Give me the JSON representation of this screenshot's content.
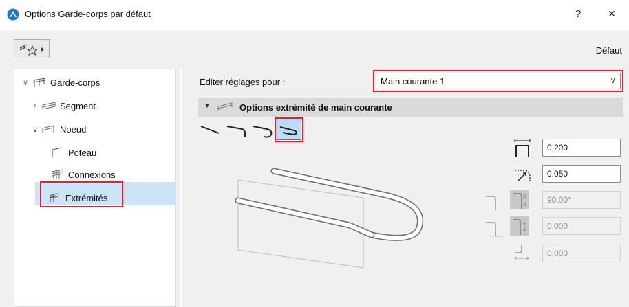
{
  "window": {
    "title": "Options Garde-corps par défaut",
    "help": "?",
    "close": "×"
  },
  "toolbar": {
    "default_label": "Défaut"
  },
  "tree": {
    "items": [
      {
        "label": "Garde-corps",
        "expanded": true
      },
      {
        "label": "Segment",
        "expanded": false
      },
      {
        "label": "Noeud",
        "expanded": true
      },
      {
        "label": "Poteau"
      },
      {
        "label": "Connexions"
      },
      {
        "label": "Extrémités",
        "selected": true
      }
    ]
  },
  "edit_settings": {
    "label": "Editer réglages pour :",
    "selected": "Main courante 1"
  },
  "section": {
    "title": "Options extrémité de main courante"
  },
  "fields": {
    "offset": "0,200",
    "radius": "0,050",
    "angle": "90,00°",
    "height": "0,000",
    "length": "0,000"
  },
  "colors": {
    "highlight": "#e2222a",
    "selection": "#cce4f7",
    "active_button": "#bcdcf4"
  }
}
